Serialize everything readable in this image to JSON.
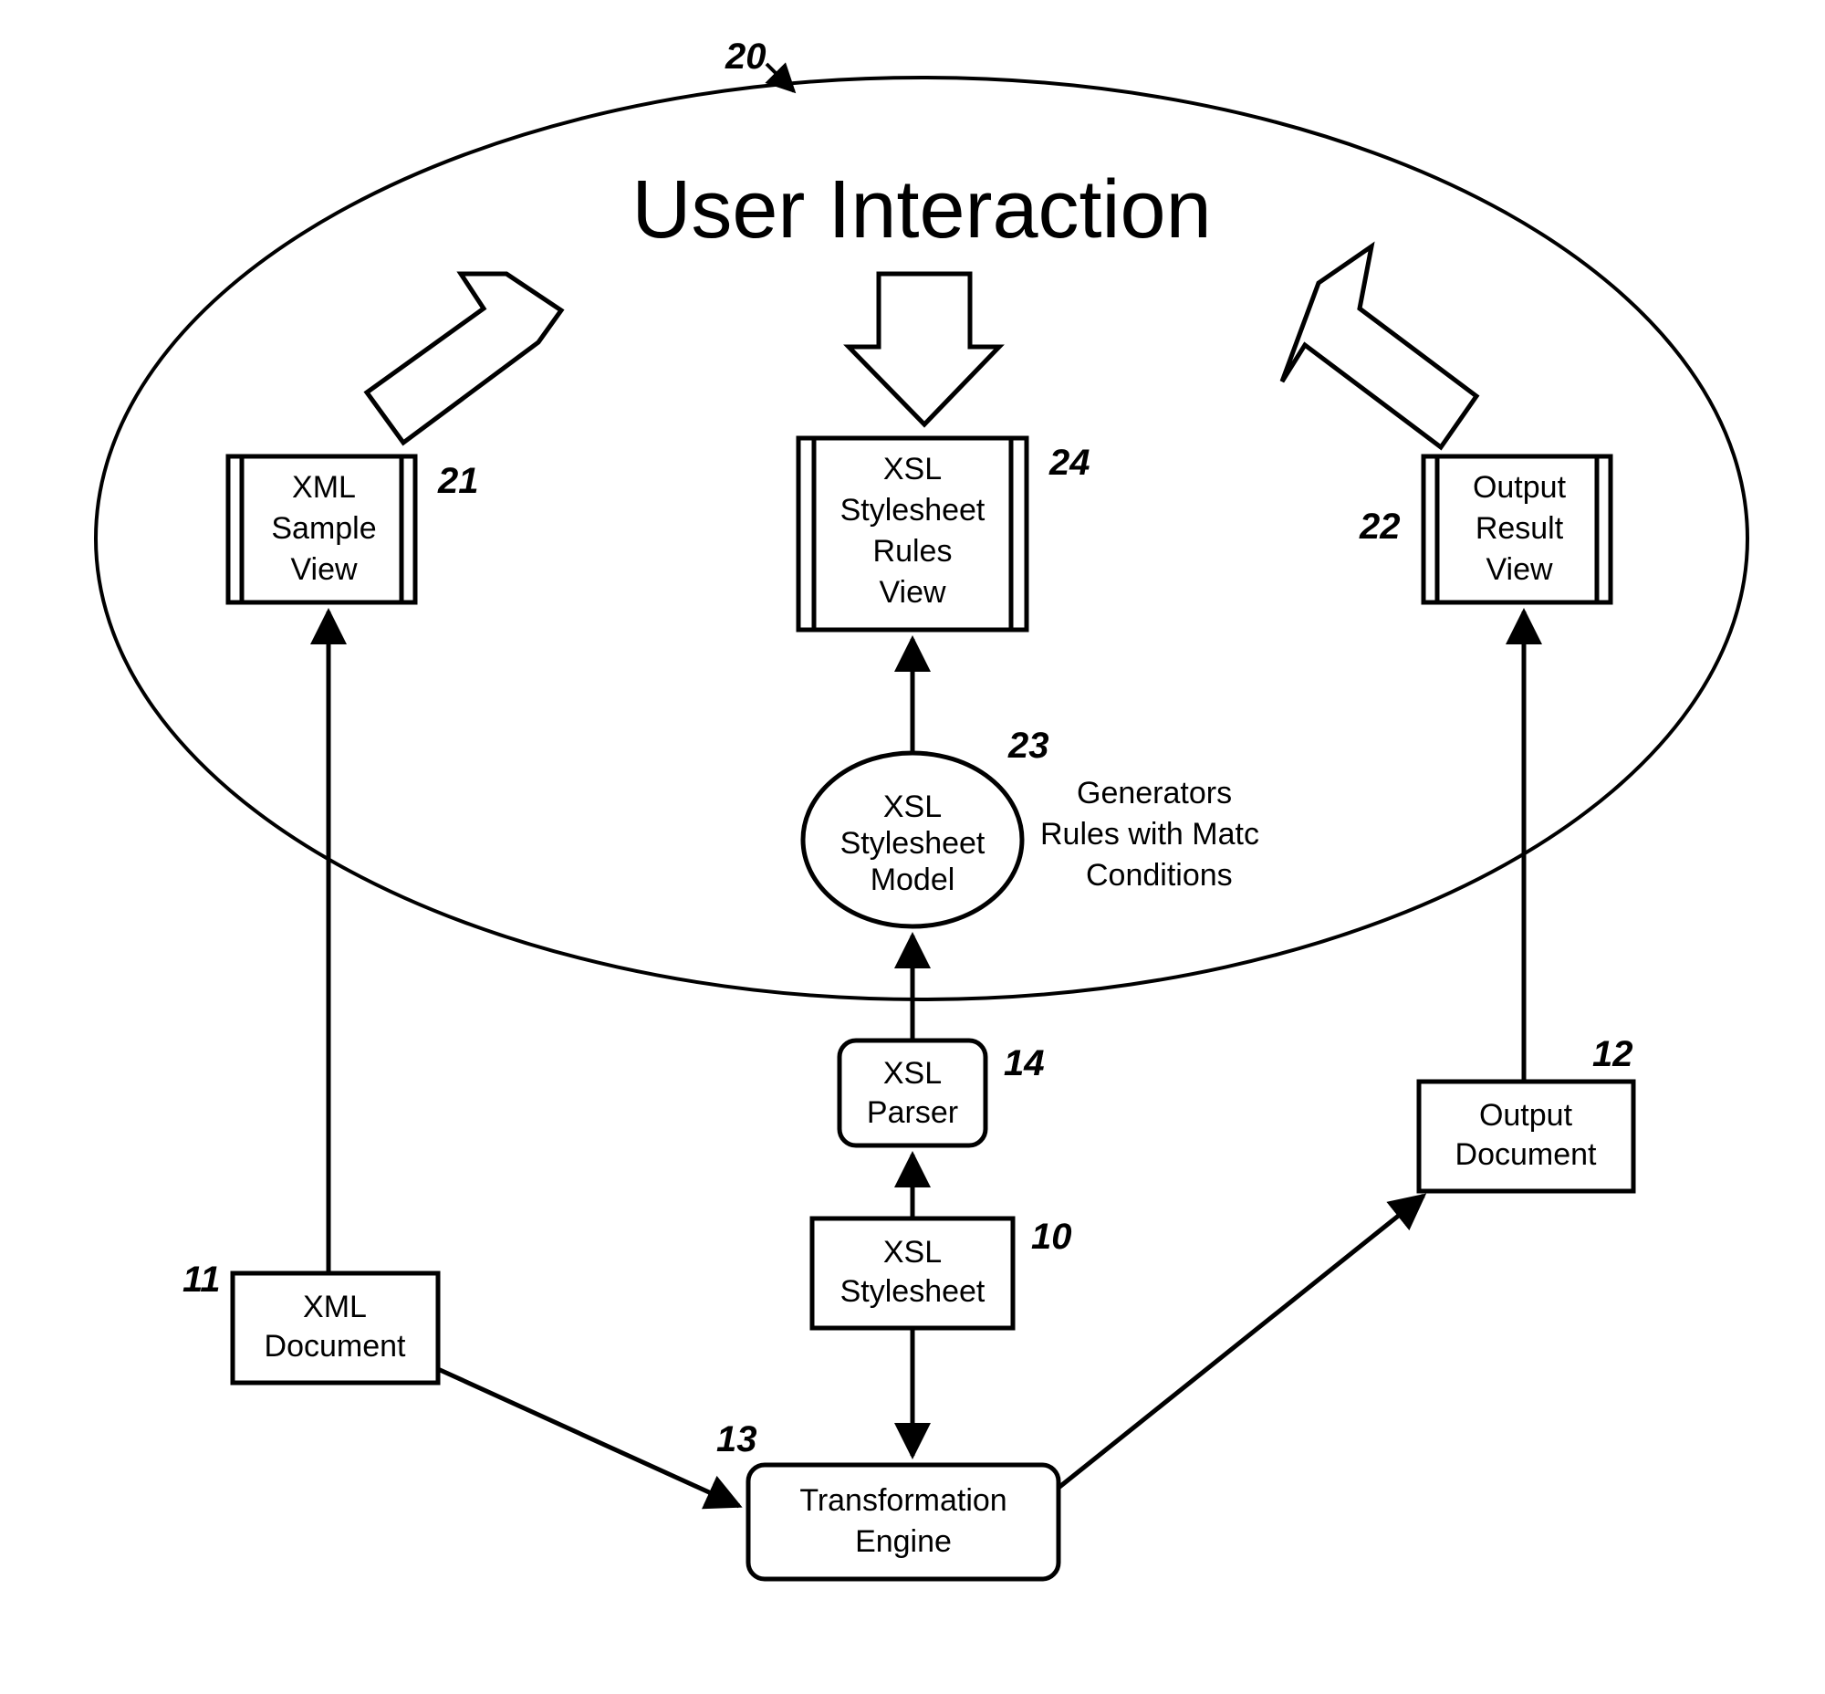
{
  "title": "User Interaction",
  "ellipse": {
    "num": "20"
  },
  "views": {
    "xml_sample": {
      "l1": "XML",
      "l2": "Sample",
      "l3": "View",
      "num": "21"
    },
    "stylesheet_rules": {
      "l1": "XSL",
      "l2": "Stylesheet",
      "l3": "Rules",
      "l4": "View",
      "num": "24"
    },
    "output_result": {
      "l1": "Output",
      "l2": "Result",
      "l3": "View",
      "num": "22"
    }
  },
  "model": {
    "l1": "XSL",
    "l2": "Stylesheet",
    "l3": "Model",
    "num": "23",
    "side_l1": "Generators",
    "side_l2": "Rules with Matc",
    "side_l3": "Conditions"
  },
  "parser": {
    "l1": "XSL",
    "l2": "Parser",
    "num": "14"
  },
  "stylesheet": {
    "l1": "XSL",
    "l2": "Stylesheet",
    "num": "10"
  },
  "xml_doc": {
    "l1": "XML",
    "l2": "Document",
    "num": "11"
  },
  "output_doc": {
    "l1": "Output",
    "l2": "Document",
    "num": "12"
  },
  "engine": {
    "l1": "Transformation",
    "l2": "Engine",
    "num": "13"
  }
}
